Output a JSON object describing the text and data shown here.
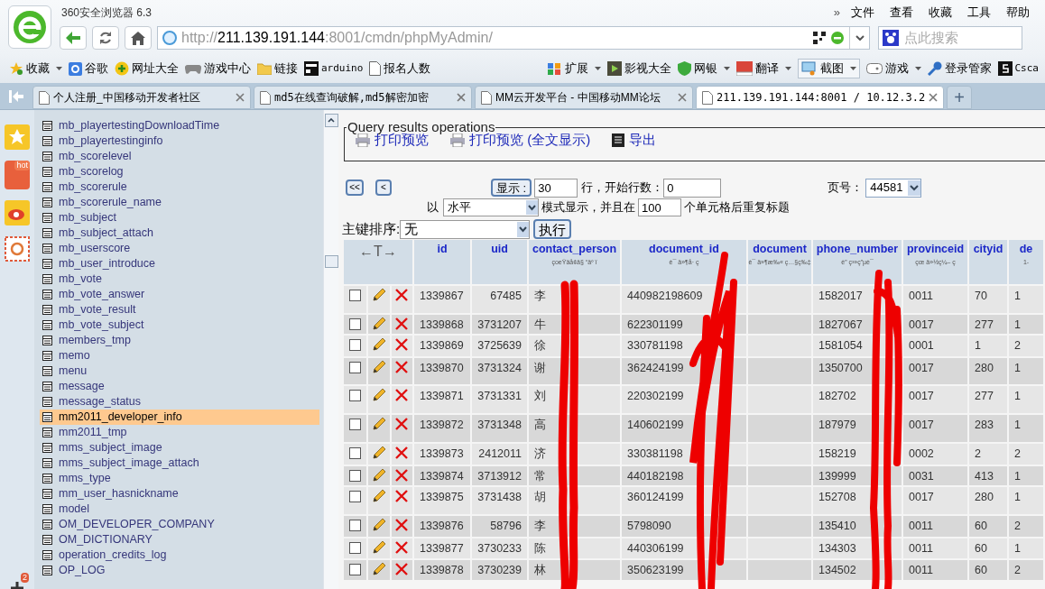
{
  "browser": {
    "title": "360安全浏览器 6.3",
    "menu_more": "»",
    "menu": [
      "文件",
      "查看",
      "收藏",
      "工具",
      "帮助"
    ],
    "address": {
      "scheme": "http://",
      "host": "211.139.191.144",
      "rest": ":8001/cmdn/phpMyAdmin/"
    },
    "search": {
      "placeholder": "点此搜索"
    },
    "bookmarks": [
      {
        "label": "收藏",
        "dropdown": true
      },
      {
        "label": "谷歌",
        "dropdown": false
      },
      {
        "label": "网址大全",
        "dropdown": false
      },
      {
        "label": "游戏中心",
        "dropdown": false
      },
      {
        "label": "链接",
        "dropdown": false
      },
      {
        "label": "arduino",
        "dropdown": false
      },
      {
        "label": "报名人数",
        "dropdown": false
      }
    ],
    "tools": [
      {
        "label": "扩展",
        "dropdown": true
      },
      {
        "label": "影视大全",
        "dropdown": false
      },
      {
        "label": "网银",
        "dropdown": true
      },
      {
        "label": "翻译",
        "dropdown": true
      },
      {
        "label": "截图",
        "dropdown": true
      },
      {
        "label": "游戏",
        "dropdown": true
      },
      {
        "label": "登录管家",
        "dropdown": false
      },
      {
        "label": "Csca",
        "dropdown": false
      }
    ],
    "tabs": [
      {
        "title": "个人注册_中国移动开发者社区",
        "selected": false
      },
      {
        "title": "md5在线查询破解,md5解密加密",
        "selected": false
      },
      {
        "title": "MM云开发平台 - 中国移动MM论坛",
        "selected": false
      },
      {
        "title": "211.139.191.144:8001 / 10.12.3.2",
        "selected": true
      }
    ],
    "new_tab": "+"
  },
  "side_rail": {
    "badge": "2",
    "hot": "hot"
  },
  "sidebar": {
    "tables": [
      {
        "name": "mb_playertestingDownloadTime",
        "selected": false
      },
      {
        "name": "mb_playertestinginfo",
        "selected": false
      },
      {
        "name": "mb_scorelevel",
        "selected": false
      },
      {
        "name": "mb_scorelog",
        "selected": false
      },
      {
        "name": "mb_scorerule",
        "selected": false
      },
      {
        "name": "mb_scorerule_name",
        "selected": false
      },
      {
        "name": "mb_subject",
        "selected": false
      },
      {
        "name": "mb_subject_attach",
        "selected": false
      },
      {
        "name": "mb_userscore",
        "selected": false
      },
      {
        "name": "mb_user_introduce",
        "selected": false
      },
      {
        "name": "mb_vote",
        "selected": false
      },
      {
        "name": "mb_vote_answer",
        "selected": false
      },
      {
        "name": "mb_vote_result",
        "selected": false
      },
      {
        "name": "mb_vote_subject",
        "selected": false
      },
      {
        "name": "members_tmp",
        "selected": false
      },
      {
        "name": "memo",
        "selected": false
      },
      {
        "name": "menu",
        "selected": false
      },
      {
        "name": "message",
        "selected": false
      },
      {
        "name": "message_status",
        "selected": false
      },
      {
        "name": "mm2011_developer_info",
        "selected": true
      },
      {
        "name": "mm2011_tmp",
        "selected": false
      },
      {
        "name": "mms_subject_image",
        "selected": false
      },
      {
        "name": "mms_subject_image_attach",
        "selected": false
      },
      {
        "name": "mms_type",
        "selected": false
      },
      {
        "name": "mm_user_hasnickname",
        "selected": false
      },
      {
        "name": "model",
        "selected": false
      },
      {
        "name": "OM_DEVELOPER_COMPANY",
        "selected": false
      },
      {
        "name": "OM_DICTIONARY",
        "selected": false
      },
      {
        "name": "operation_credits_log",
        "selected": false
      },
      {
        "name": "OP_LOG",
        "selected": false
      }
    ]
  },
  "query_ops": {
    "legend": "Query results operations",
    "actions": [
      {
        "label": "打印预览"
      },
      {
        "label": "打印预览",
        "suffix": "(全文显示)"
      },
      {
        "label": "导出"
      }
    ]
  },
  "navigation": {
    "first": "<<",
    "prev": "<",
    "show_button": "显示 :",
    "rows": "30",
    "rows_label": "行，开始行数：",
    "start": "0",
    "page_label": "页号：",
    "page": "44581",
    "mode_prefix": "以",
    "mode": "水平",
    "mode_label": "模式显示，并且在",
    "repeat": "100",
    "repeat_label": "个单元格后重复标题",
    "sort_label": "主键排序:",
    "sort": "无",
    "go": "执行"
  },
  "table": {
    "arrows": "←T→",
    "columns": [
      {
        "name": "id"
      },
      {
        "name": "uid"
      },
      {
        "name": "contact_person",
        "comment": "çoeŸäå¢ä§ “äº ï"
      },
      {
        "name": "document_id",
        "comment": "è¯ ä»¶å· ç"
      },
      {
        "name": "document",
        "comment": "è¯ ä»¶æ‰« ç…§ç‰‡"
      },
      {
        "name": "phone_number",
        "comment": "è” ç³»ç”µè¯"
      },
      {
        "name": "provinceid",
        "comment": "çœ ä»½ç¼– ç"
      },
      {
        "name": "cityid"
      },
      {
        "name": "de",
        "comment": "1-"
      }
    ],
    "rows": [
      {
        "checked": false,
        "cells": [
          "1339867",
          "67485",
          "李",
          "440982198609",
          null,
          "1582017",
          "0011",
          "70",
          "1"
        ]
      },
      {
        "checked": false,
        "cells": [
          "1339868",
          "3731207",
          "牛",
          "622301199",
          null,
          "1827067",
          "0017",
          "277",
          "1"
        ]
      },
      {
        "checked": false,
        "cells": [
          "1339869",
          "3725639",
          "徐",
          "330781198",
          null,
          "1581054",
          "0001",
          "1",
          "2"
        ]
      },
      {
        "checked": false,
        "cells": [
          "1339870",
          "3731324",
          "谢",
          "362424199",
          null,
          "1350700",
          "0017",
          "280",
          "1"
        ]
      },
      {
        "checked": false,
        "cells": [
          "1339871",
          "3731331",
          "刘",
          "220302199",
          null,
          "182702",
          "0017",
          "277",
          "1"
        ]
      },
      {
        "checked": false,
        "cells": [
          "1339872",
          "3731348",
          "高",
          "140602199",
          null,
          "187979",
          "0017",
          "283",
          "1"
        ]
      },
      {
        "checked": false,
        "cells": [
          "1339873",
          "2412011",
          "济",
          "330381198",
          null,
          "158219",
          "0002",
          "2",
          "2"
        ]
      },
      {
        "checked": false,
        "cells": [
          "1339874",
          "3713912",
          "常",
          "440182198",
          null,
          "139999",
          "0031",
          "413",
          "1"
        ]
      },
      {
        "checked": false,
        "cells": [
          "1339875",
          "3731438",
          "胡",
          "360124199",
          null,
          "152708",
          "0017",
          "280",
          "1"
        ]
      },
      {
        "checked": false,
        "cells": [
          "1339876",
          "58796",
          "李",
          "5798090",
          null,
          "135410",
          "0011",
          "60",
          "2"
        ]
      },
      {
        "checked": false,
        "cells": [
          "1339877",
          "3730233",
          "陈",
          "440306199",
          null,
          "134303",
          "0011",
          "60",
          "1"
        ]
      },
      {
        "checked": false,
        "cells": [
          "1339878",
          "3730239",
          "林",
          "350623199",
          null,
          "134502",
          "0011",
          "60",
          "2"
        ]
      }
    ]
  }
}
